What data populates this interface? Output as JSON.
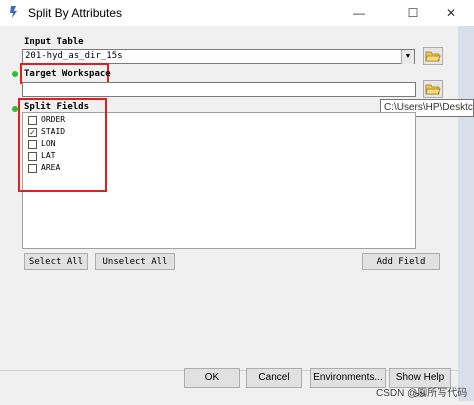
{
  "window": {
    "title": "Split By Attributes",
    "minimize_glyph": "—",
    "maximize_glyph": "☐",
    "close_glyph": "✕"
  },
  "input_table": {
    "label": "Input Table",
    "value": "201-hyd_as_dir_15s"
  },
  "target_workspace": {
    "label": "Target Workspace",
    "value": "",
    "tooltip": "C:\\Users\\HP\\Desktc"
  },
  "split_fields": {
    "label": "Split Fields",
    "items": [
      {
        "label": "ORDER",
        "checked": false
      },
      {
        "label": "STAID",
        "checked": true
      },
      {
        "label": "LON",
        "checked": false
      },
      {
        "label": "LAT",
        "checked": false
      },
      {
        "label": "AREA",
        "checked": false
      }
    ]
  },
  "buttons": {
    "select_all": "Select All",
    "unselect_all": "Unselect All",
    "add_field": "Add Field",
    "ok": "OK",
    "cancel": "Cancel",
    "environments": "Environments...",
    "show_help": "Show Help >>"
  },
  "watermark": "CSDN @厕所写代码",
  "icons": {
    "app": "arcgis-tool-icon",
    "folder": "folder-open-icon",
    "dropdown": "chevron-down-icon",
    "required": "green-dot-icon"
  },
  "colors": {
    "highlight": "#e02020",
    "required_dot": "#2dbd2d"
  }
}
